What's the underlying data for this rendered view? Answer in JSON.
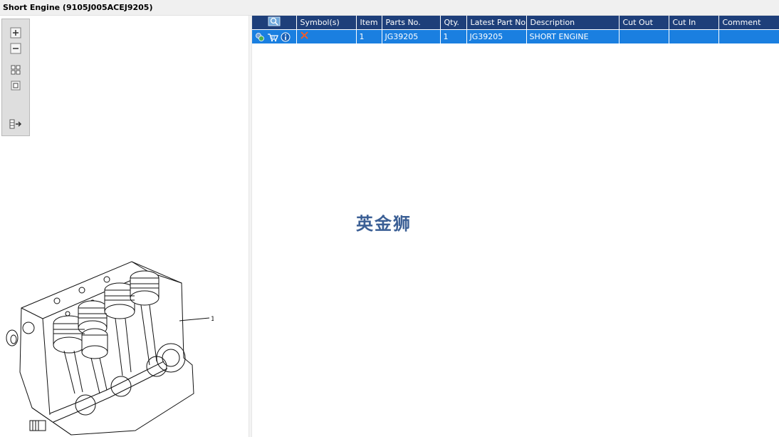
{
  "window": {
    "title": "Short Engine (9105J005ACEJ9205)"
  },
  "toolbox": {
    "zoom_in": "zoom-in-icon",
    "zoom_out": "zoom-out-icon",
    "fit_all": "fit-all-icon",
    "actual_size": "actual-size-icon",
    "toggle_panel": "toggle-panel-icon"
  },
  "drawing": {
    "callout": "1"
  },
  "table": {
    "headers": [
      "",
      "Symbol(s)",
      "Item",
      "Parts No.",
      "Qty.",
      "Latest Part No.",
      "Description",
      "Cut Out",
      "Cut In",
      "Comment"
    ],
    "rows": [
      {
        "symbol": "remove-icon",
        "item": "1",
        "parts_no": "JG39205",
        "qty": "1",
        "latest_part_no": "JG39205",
        "description": "SHORT ENGINE",
        "cut_out": "",
        "cut_in": "",
        "comment": ""
      }
    ]
  },
  "watermark": "英金狮",
  "colors": {
    "header_bg": "#1e3f7a",
    "row_selected": "#1a7fe0",
    "accent": "#3b5f95"
  }
}
